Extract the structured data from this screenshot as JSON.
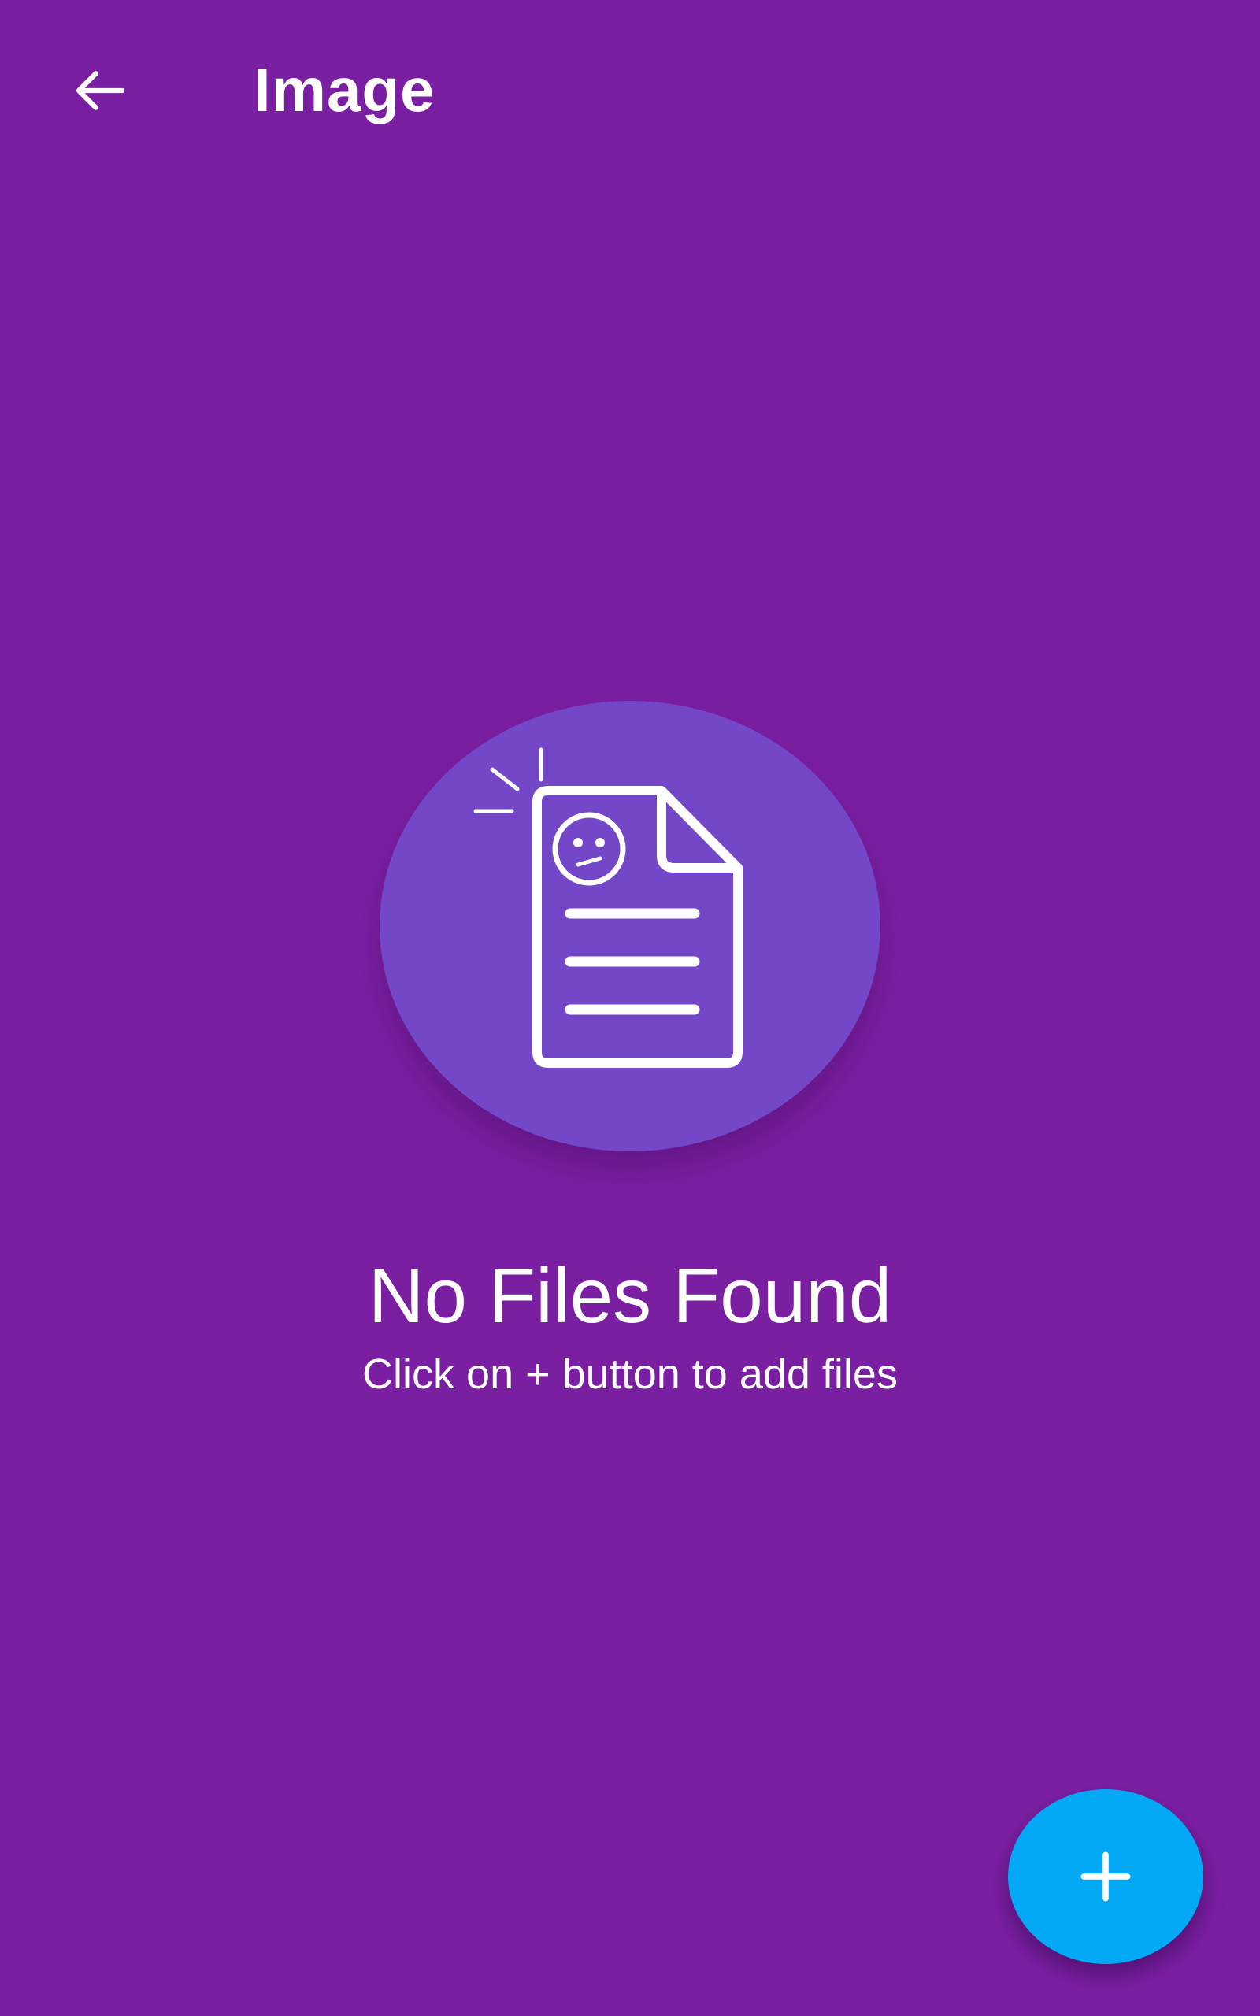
{
  "appbar": {
    "title": "Image",
    "back_icon": "arrow-back-icon"
  },
  "empty_state": {
    "illustration_icon": "sad-document-icon",
    "title": "No Files Found",
    "subtitle": "Click on + button to add files"
  },
  "fab": {
    "icon": "plus-icon"
  },
  "colors": {
    "background": "#7B1FA2",
    "illustration_circle": "#7447C9",
    "fab": "#03A9F4",
    "foreground": "#FFFFFF"
  }
}
